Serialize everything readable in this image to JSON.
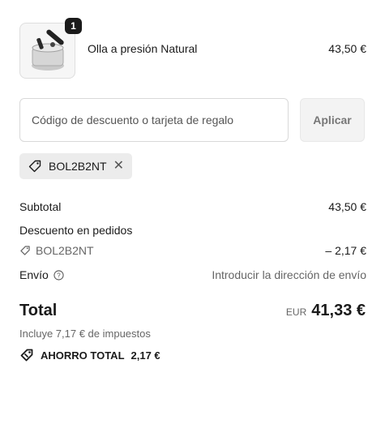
{
  "line_item": {
    "quantity": "1",
    "name": "Olla a presión Natural",
    "price": "43,50 €",
    "thumbnail_icon": "pressure-cooker-icon"
  },
  "discount": {
    "placeholder": "Código de descuento o tarjeta de regalo",
    "value": "",
    "apply_label": "Aplicar",
    "applied_code": "BOL2B2NT"
  },
  "summary": {
    "subtotal_label": "Subtotal",
    "subtotal_value": "43,50 €",
    "order_discount_label": "Descuento en pedidos",
    "order_discount_code": "BOL2B2NT",
    "order_discount_value": "– 2,17 €",
    "shipping_label": "Envío",
    "shipping_value": "Introducir la dirección de envío",
    "total_label": "Total",
    "total_currency": "EUR",
    "total_value": "41,33 €",
    "taxes_note": "Incluye 7,17 € de impuestos",
    "savings_label": "AHORRO TOTAL",
    "savings_value": "2,17 €"
  },
  "colors": {
    "text": "#1a1a1a",
    "muted": "#666666",
    "tag_bg": "#ececec",
    "button_bg": "#f3f3f3"
  }
}
